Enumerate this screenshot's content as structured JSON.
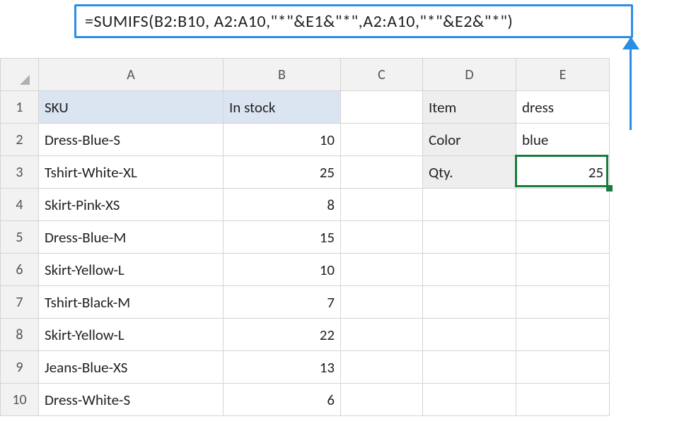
{
  "formula": "=SUMIFS(B2:B10, A2:A10,\"*\"&E1&\"*\",A2:A10,\"*\"&E2&\"*\")",
  "columns": [
    "A",
    "B",
    "C",
    "D",
    "E"
  ],
  "row_numbers": [
    "1",
    "2",
    "3",
    "4",
    "5",
    "6",
    "7",
    "8",
    "9",
    "10"
  ],
  "headers": {
    "A1": "SKU",
    "B1": "In stock"
  },
  "labels": {
    "D1": "Item",
    "D2": "Color",
    "D3": "Qty."
  },
  "inputs": {
    "E1": "dress",
    "E2": "blue",
    "E3": "25"
  },
  "sku": [
    "Dress-Blue-S",
    "Tshirt-White-XL",
    "Skirt-Pink-XS",
    "Dress-Blue-M",
    "Skirt-Yellow-L",
    "Tshirt-Black-M",
    "Skirt-Yellow-L",
    "Jeans-Blue-XS",
    "Dress-White-S"
  ],
  "stock": [
    "10",
    "25",
    "8",
    "15",
    "10",
    "7",
    "22",
    "13",
    "6"
  ],
  "active_cell": "E3"
}
